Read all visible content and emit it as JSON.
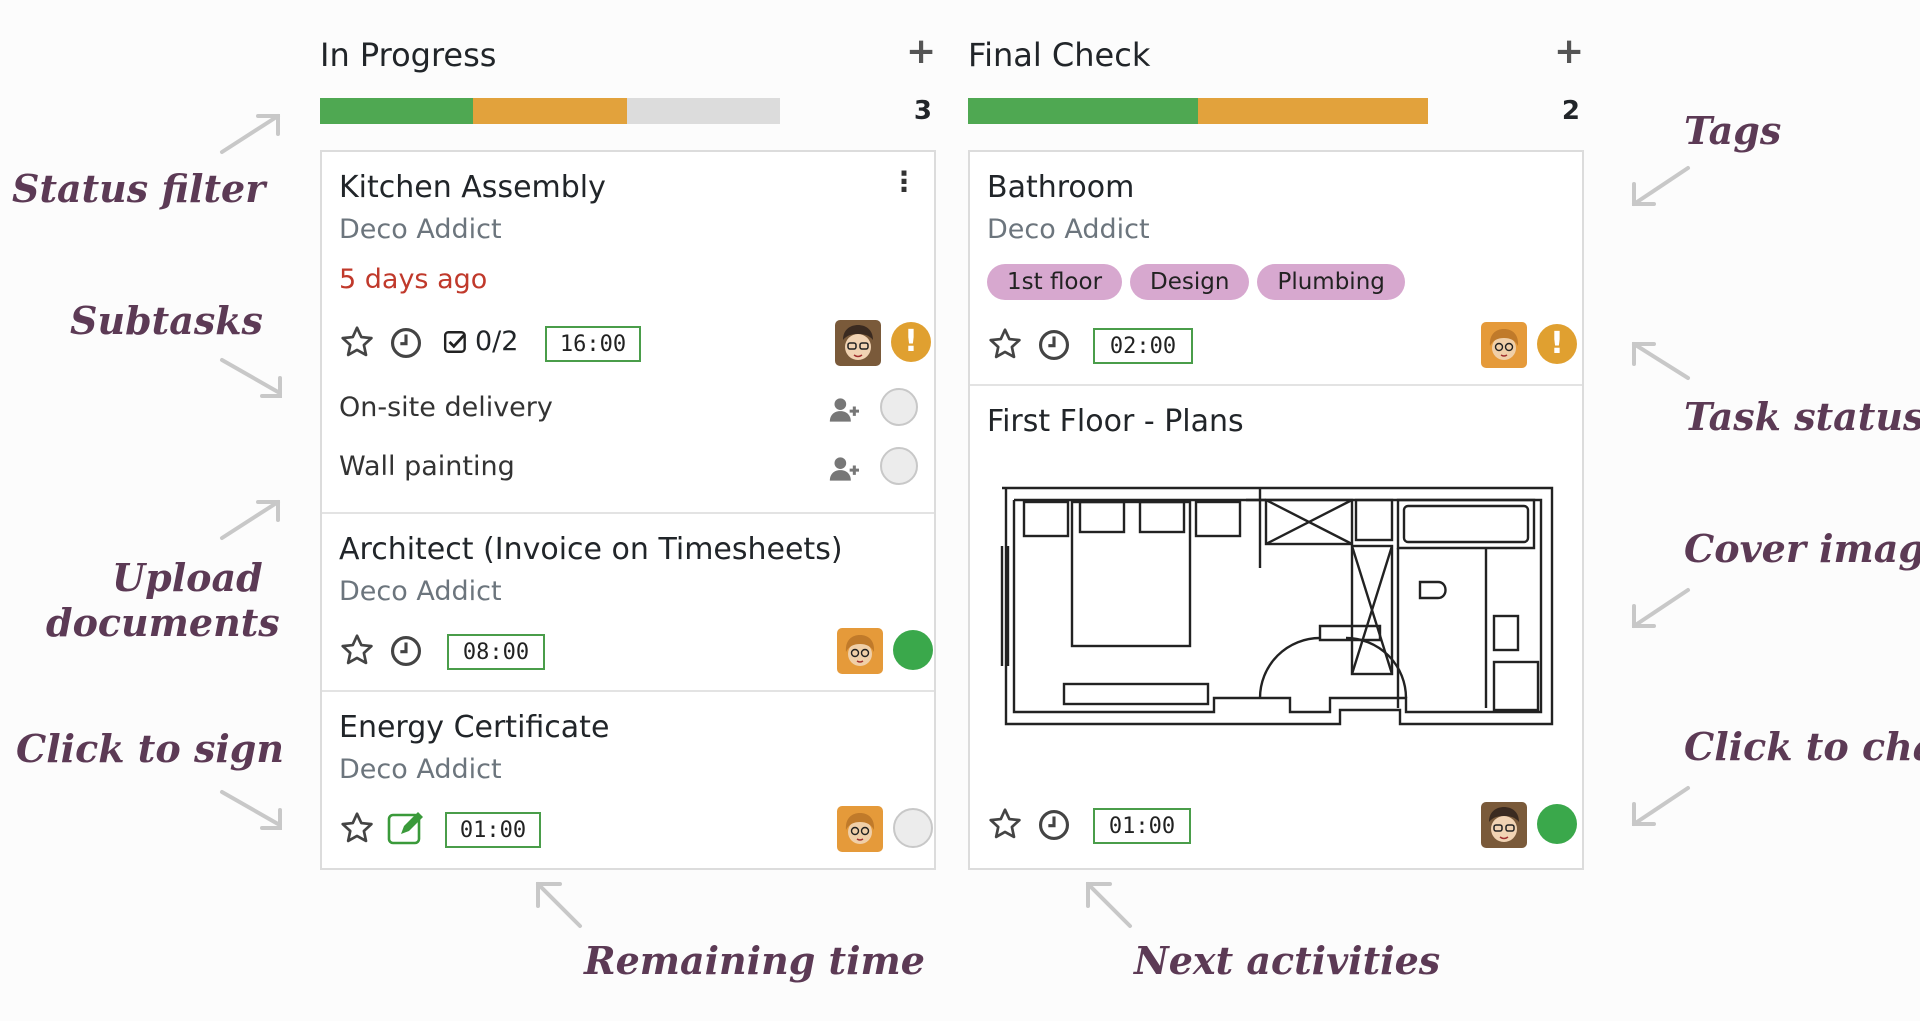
{
  "columns": [
    {
      "title": "In Progress",
      "count": "3",
      "progress": [
        {
          "color": "#4fa852",
          "fraction": 0.3333
        },
        {
          "color": "#e2a23c",
          "fraction": 0.3333
        },
        {
          "color": "#dcdcdc",
          "fraction": 0.3334
        }
      ],
      "cards": [
        {
          "title": "Kitchen Assembly",
          "customer": "Deco Addict",
          "deadline": "5 days ago",
          "subtask_count": "0/2",
          "time": "16:00",
          "status": "warning",
          "subtasks": [
            {
              "label": "On-site delivery"
            },
            {
              "label": "Wall painting"
            }
          ]
        },
        {
          "title": "Architect (Invoice on Timesheets)",
          "customer": "Deco Addict",
          "time": "08:00",
          "status": "done"
        },
        {
          "title": "Energy Certificate",
          "customer": "Deco Addict",
          "time": "01:00",
          "status": "normal"
        }
      ]
    },
    {
      "title": "Final Check",
      "count": "2",
      "progress": [
        {
          "color": "#4fa852",
          "fraction": 0.5
        },
        {
          "color": "#e2a23c",
          "fraction": 0.5
        }
      ],
      "cards": [
        {
          "title": "Bathroom",
          "customer": "Deco Addict",
          "tags": [
            "1st floor",
            "Design",
            "Plumbing"
          ],
          "time": "02:00",
          "status": "warning"
        },
        {
          "title": "First Floor - Plans",
          "time": "01:00",
          "status": "done"
        }
      ]
    }
  ],
  "annotations": {
    "status_filter": "Status filter",
    "subtasks": "Subtasks",
    "upload_documents_line1": "Upload",
    "upload_documents_line2": "documents",
    "click_to_sign": "Click to sign",
    "tags": "Tags",
    "task_status": "Task status",
    "cover_image": "Cover image",
    "click_to_chat": "Click to chat",
    "remaining_time": "Remaining time",
    "next_activities": "Next activities"
  },
  "icons": {
    "star": "star-icon",
    "clock": "clock-icon",
    "checkbox": "checkbox-icon",
    "sign": "sign-icon",
    "add_user": "add-user-icon",
    "menu": "kebab-menu-icon",
    "plus": "plus-icon"
  },
  "colors": {
    "green": "#4fa852",
    "orange": "#e2a23c",
    "grey": "#dcdcdc",
    "deadline_red": "#c0392b",
    "tag_pink": "#d7a8cf",
    "annotation_purple": "#5c3a55",
    "timer_border": "#4a9d4a"
  }
}
